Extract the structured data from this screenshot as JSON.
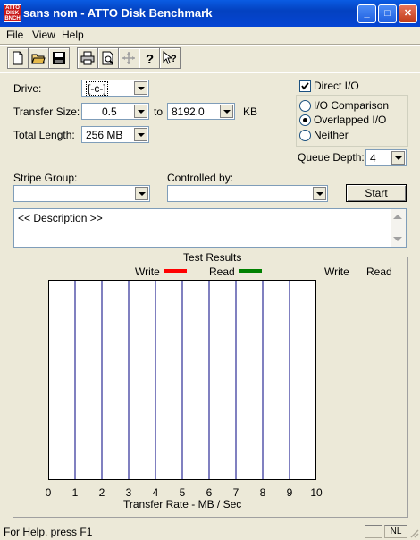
{
  "window": {
    "title": "sans nom - ATTO Disk Benchmark",
    "icon_text": "ATTO DISK BNCH",
    "minimize_glyph": "_",
    "maximize_glyph": "□",
    "close_glyph": "✕"
  },
  "menu": {
    "file": "File",
    "view": "View",
    "help": "Help"
  },
  "toolbar": {
    "icons": [
      "new-document-icon",
      "open-folder-icon",
      "save-disk-icon",
      "print-icon",
      "print-preview-icon",
      "move-icon",
      "help-icon",
      "context-help-icon"
    ]
  },
  "form": {
    "drive_label": "Drive:",
    "drive_value": "[-c-]",
    "transfer_size_label": "Transfer Size:",
    "transfer_from": "0.5",
    "to_label": "to",
    "transfer_to": "8192.0",
    "kb_label": "KB",
    "total_length_label": "Total Length:",
    "total_length_value": "256 MB",
    "direct_io_label": "Direct I/O",
    "direct_io_checked": true,
    "io_options": [
      {
        "label": "I/O Comparison",
        "selected": false
      },
      {
        "label": "Overlapped I/O",
        "selected": true
      },
      {
        "label": "Neither",
        "selected": false
      }
    ],
    "queue_depth_label": "Queue Depth:",
    "queue_depth_value": "4",
    "stripe_group_label": "Stripe Group:",
    "stripe_group_value": "",
    "controlled_by_label": "Controlled by:",
    "controlled_by_value": "",
    "start_button": "Start",
    "description": "<< Description >>"
  },
  "results": {
    "group_title": "Test Results",
    "legend_write": "Write",
    "legend_read": "Read",
    "col_write": "Write",
    "col_read": "Read",
    "write_color": "#ff0000",
    "read_color": "#008000",
    "grid_color": "#000080",
    "x_ticks": [
      "0",
      "1",
      "2",
      "3",
      "4",
      "5",
      "6",
      "7",
      "8",
      "9",
      "10"
    ],
    "xlabel": "Transfer Rate - MB / Sec"
  },
  "status": {
    "help_text": "For Help, press F1",
    "num_lock": "NL"
  }
}
